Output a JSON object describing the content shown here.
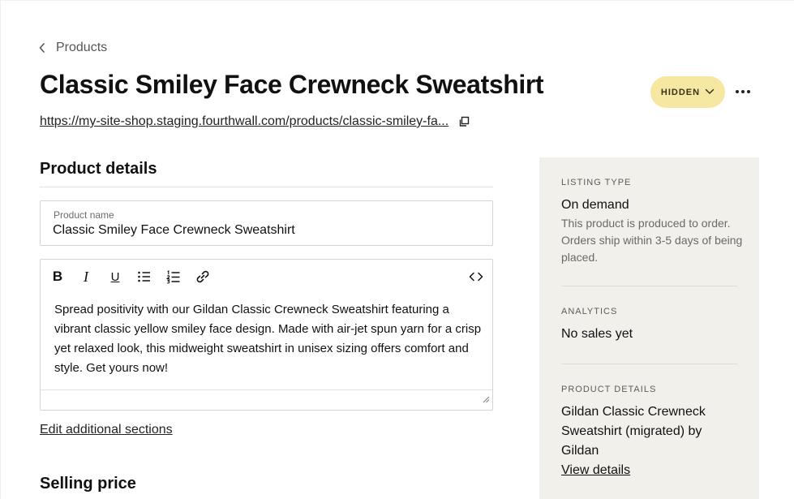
{
  "nav": {
    "back_label": "Products"
  },
  "header": {
    "title": "Classic Smiley Face Crewneck Sweatshirt",
    "status_label": "HIDDEN",
    "status_color": "#f6e7a3",
    "product_url": "https://my-site-shop.staging.fourthwall.com/products/classic-smiley-fa..."
  },
  "product_details": {
    "heading": "Product details",
    "name_field": {
      "label": "Product name",
      "value": "Classic Smiley Face Crewneck Sweatshirt"
    },
    "editor": {
      "toolbar": {
        "bold": "B",
        "italic": "I",
        "underline": "U",
        "icons": [
          "bold-icon",
          "italic-icon",
          "underline-icon",
          "bullet-list-icon",
          "numbered-list-icon",
          "link-icon",
          "code-view-icon"
        ]
      },
      "description": "Spread positivity with our Gildan Classic Crewneck Sweatshirt featuring a vibrant classic yellow smiley face design. Made with air-jet spun yarn for a crisp yet relaxed look, this midweight sweatshirt in unisex sizing offers comfort and style. Get yours now!"
    },
    "edit_sections_link": "Edit additional sections"
  },
  "selling_price": {
    "heading": "Selling price"
  },
  "sidebar": {
    "background": "#f1f0eb",
    "listing_type": {
      "caption": "LISTING TYPE",
      "value": "On demand",
      "description": "This product is produced to order. Orders ship within 3-5 days of being placed."
    },
    "analytics": {
      "caption": "ANALYTICS",
      "value": "No sales yet"
    },
    "product_details": {
      "caption": "PRODUCT DETAILS",
      "text": "Gildan Classic Crewneck Sweatshirt (migrated) by Gildan",
      "link": "View details"
    }
  }
}
